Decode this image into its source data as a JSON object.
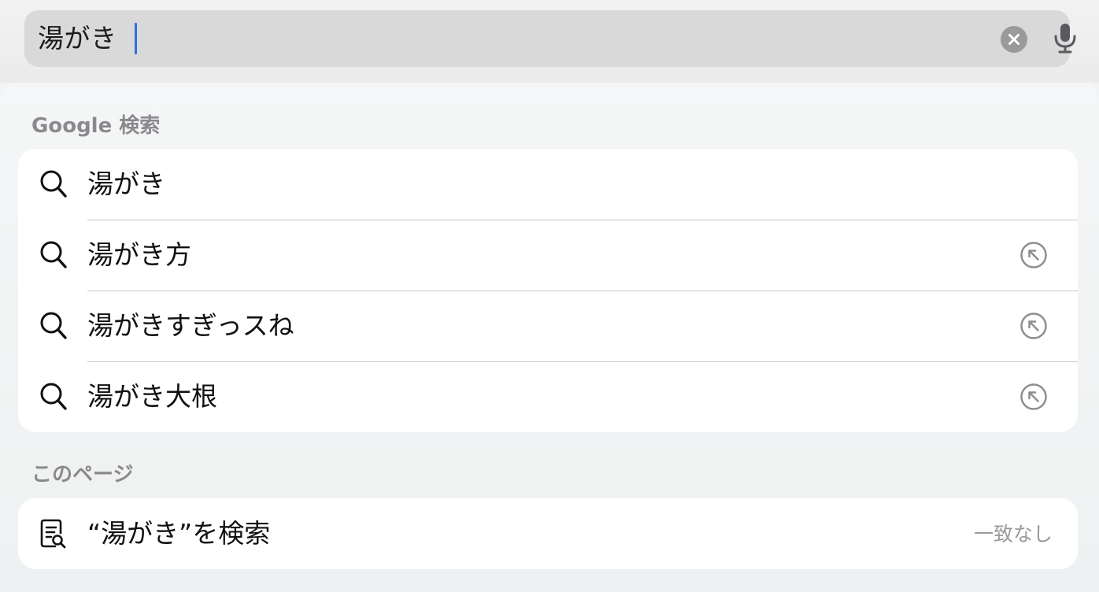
{
  "search": {
    "value": "湯がき",
    "clear_icon": "clear-circle-icon",
    "mic_icon": "microphone-icon",
    "caret_color": "#2F6FE4"
  },
  "google_section": {
    "label": "Google 検索",
    "suggestions": [
      {
        "text": "湯がき",
        "icon": "search-icon",
        "has_fill": false
      },
      {
        "text": "湯がき方",
        "icon": "search-icon",
        "has_fill": true
      },
      {
        "text": "湯がきすぎっスね",
        "icon": "search-icon",
        "has_fill": true
      },
      {
        "text": "湯がき大根",
        "icon": "search-icon",
        "has_fill": true
      }
    ]
  },
  "page_section": {
    "label": "このページ",
    "find": {
      "text": "“湯がき”を検索",
      "status": "一致なし",
      "icon": "find-in-page-icon"
    }
  }
}
